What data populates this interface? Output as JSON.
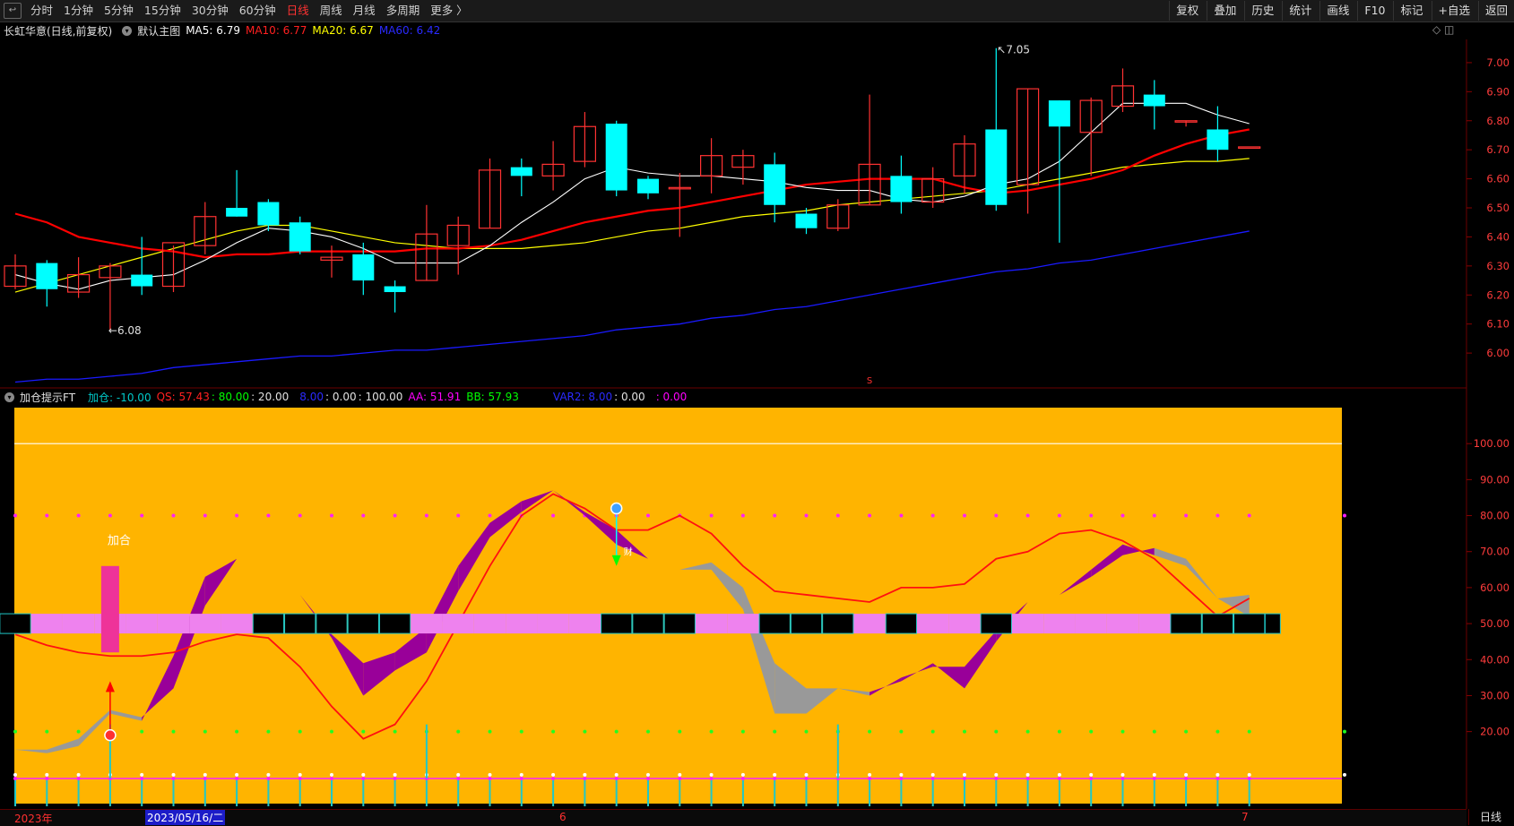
{
  "toolbar": {
    "back_icon": "back-arrow-icon",
    "periods": [
      "分时",
      "1分钟",
      "5分钟",
      "15分钟",
      "30分钟",
      "60分钟",
      "日线",
      "周线",
      "月线",
      "多周期",
      "更多 〉"
    ],
    "active_period": "日线",
    "right_buttons": [
      "复权",
      "叠加",
      "历史",
      "统计",
      "画线",
      "F10",
      "标记",
      "+自选",
      "返回"
    ]
  },
  "main_info": {
    "stock": "长虹华意(日线,前复权)",
    "template": "默认主图",
    "ma5": "MA5: 6.79",
    "ma10": "MA10: 6.77",
    "ma20": "MA20: 6.67",
    "ma60": "MA60: 6.42",
    "controls": "◇ ◫"
  },
  "indicator_info": {
    "name": "加仓提示FT",
    "jiacang": "加仓: -10.00",
    "qs": "QS: 57.43",
    "v1": ": 80.00",
    "v2": ": 20.00",
    "v3": "8.00",
    "v4": ": 0.00",
    "v5": ": 100.00",
    "aa": "AA: 51.91",
    "bb": "BB: 57.93",
    "var2": "VAR2: 8.00",
    "v6": ": 0.00",
    "v7": ": 0.00"
  },
  "annotations": {
    "high_label": "7.05",
    "low_label": "6.08",
    "jiacang_label": "加合",
    "cai_glyph": "财",
    "s_marker": "S"
  },
  "price_axis": [
    "7.00",
    "6.90",
    "6.80",
    "6.70",
    "6.60",
    "6.50",
    "6.40",
    "6.30",
    "6.20",
    "6.10",
    "6.00"
  ],
  "ind_axis": [
    "100.00",
    "90.00",
    "80.00",
    "70.00",
    "60.00",
    "50.00",
    "40.00",
    "30.00",
    "20.00"
  ],
  "date_axis": {
    "start": "2023年",
    "cursor": "2023/05/16/二",
    "m6": "6",
    "m7": "7"
  },
  "period_label": "日线",
  "colors": {
    "up": "#ff3232",
    "down": "#00ffff",
    "ma5": "#ffffff",
    "ma10": "#ff0000",
    "ma20": "#ffff00",
    "ma60": "#1a1aff",
    "panel": "#ffb400"
  },
  "chart_data": {
    "type": "candlestick",
    "ylim": [
      5.88,
      7.08
    ],
    "candles": [
      {
        "o": 6.23,
        "h": 6.34,
        "l": 6.22,
        "c": 6.3
      },
      {
        "o": 6.31,
        "h": 6.32,
        "l": 6.16,
        "c": 6.22
      },
      {
        "o": 6.21,
        "h": 6.33,
        "l": 6.19,
        "c": 6.27
      },
      {
        "o": 6.26,
        "h": 6.31,
        "l": 6.08,
        "c": 6.3
      },
      {
        "o": 6.27,
        "h": 6.4,
        "l": 6.2,
        "c": 6.23
      },
      {
        "o": 6.23,
        "h": 6.37,
        "l": 6.21,
        "c": 6.38
      },
      {
        "o": 6.37,
        "h": 6.52,
        "l": 6.34,
        "c": 6.47
      },
      {
        "o": 6.5,
        "h": 6.63,
        "l": 6.47,
        "c": 6.47
      },
      {
        "o": 6.52,
        "h": 6.53,
        "l": 6.42,
        "c": 6.44
      },
      {
        "o": 6.45,
        "h": 6.47,
        "l": 6.34,
        "c": 6.35
      },
      {
        "o": 6.32,
        "h": 6.37,
        "l": 6.26,
        "c": 6.33
      },
      {
        "o": 6.34,
        "h": 6.38,
        "l": 6.2,
        "c": 6.25
      },
      {
        "o": 6.23,
        "h": 6.25,
        "l": 6.14,
        "c": 6.21
      },
      {
        "o": 6.25,
        "h": 6.51,
        "l": 6.25,
        "c": 6.41
      },
      {
        "o": 6.37,
        "h": 6.47,
        "l": 6.27,
        "c": 6.44
      },
      {
        "o": 6.43,
        "h": 6.67,
        "l": 6.43,
        "c": 6.63
      },
      {
        "o": 6.64,
        "h": 6.67,
        "l": 6.54,
        "c": 6.61
      },
      {
        "o": 6.61,
        "h": 6.73,
        "l": 6.56,
        "c": 6.65
      },
      {
        "o": 6.66,
        "h": 6.83,
        "l": 6.64,
        "c": 6.78
      },
      {
        "o": 6.79,
        "h": 6.8,
        "l": 6.54,
        "c": 6.56
      },
      {
        "o": 6.6,
        "h": 6.61,
        "l": 6.53,
        "c": 6.55
      },
      {
        "o": 6.57,
        "h": 6.62,
        "l": 6.4,
        "c": 6.57
      },
      {
        "o": 6.61,
        "h": 6.74,
        "l": 6.55,
        "c": 6.68
      },
      {
        "o": 6.64,
        "h": 6.7,
        "l": 6.58,
        "c": 6.68
      },
      {
        "o": 6.65,
        "h": 6.69,
        "l": 6.45,
        "c": 6.51
      },
      {
        "o": 6.48,
        "h": 6.5,
        "l": 6.41,
        "c": 6.43
      },
      {
        "o": 6.43,
        "h": 6.53,
        "l": 6.42,
        "c": 6.51
      },
      {
        "o": 6.51,
        "h": 6.89,
        "l": 6.51,
        "c": 6.65
      },
      {
        "o": 6.61,
        "h": 6.68,
        "l": 6.48,
        "c": 6.52
      },
      {
        "o": 6.52,
        "h": 6.64,
        "l": 6.5,
        "c": 6.6
      },
      {
        "o": 6.61,
        "h": 6.75,
        "l": 6.55,
        "c": 6.72
      },
      {
        "o": 6.77,
        "h": 7.05,
        "l": 6.49,
        "c": 6.51
      },
      {
        "o": 6.58,
        "h": 6.91,
        "l": 6.48,
        "c": 6.91
      },
      {
        "o": 6.87,
        "h": 6.87,
        "l": 6.38,
        "c": 6.78
      },
      {
        "o": 6.76,
        "h": 6.88,
        "l": 6.61,
        "c": 6.87
      },
      {
        "o": 6.85,
        "h": 6.98,
        "l": 6.83,
        "c": 6.92
      },
      {
        "o": 6.89,
        "h": 6.94,
        "l": 6.77,
        "c": 6.85
      },
      {
        "o": 6.8,
        "h": 6.8,
        "l": 6.78,
        "c": 6.8
      },
      {
        "o": 6.77,
        "h": 6.85,
        "l": 6.66,
        "c": 6.7
      },
      {
        "o": 6.71,
        "h": 6.71,
        "l": 6.71,
        "c": 6.71
      }
    ],
    "ma5": [
      6.27,
      6.24,
      6.22,
      6.25,
      6.26,
      6.27,
      6.32,
      6.38,
      6.43,
      6.42,
      6.4,
      6.36,
      6.31,
      6.31,
      6.31,
      6.37,
      6.45,
      6.52,
      6.6,
      6.64,
      6.62,
      6.61,
      6.61,
      6.6,
      6.59,
      6.57,
      6.56,
      6.56,
      6.53,
      6.52,
      6.54,
      6.58,
      6.6,
      6.66,
      6.76,
      6.86,
      6.86,
      6.86,
      6.82,
      6.79
    ],
    "ma10": [
      6.48,
      6.45,
      6.4,
      6.38,
      6.36,
      6.35,
      6.33,
      6.34,
      6.34,
      6.35,
      6.35,
      6.35,
      6.35,
      6.36,
      6.36,
      6.37,
      6.39,
      6.42,
      6.45,
      6.47,
      6.49,
      6.5,
      6.52,
      6.54,
      6.56,
      6.58,
      6.59,
      6.6,
      6.6,
      6.6,
      6.57,
      6.55,
      6.56,
      6.58,
      6.6,
      6.63,
      6.68,
      6.72,
      6.75,
      6.77
    ],
    "ma20": [
      6.21,
      6.24,
      6.27,
      6.3,
      6.33,
      6.36,
      6.39,
      6.42,
      6.44,
      6.44,
      6.42,
      6.4,
      6.38,
      6.37,
      6.36,
      6.36,
      6.36,
      6.37,
      6.38,
      6.4,
      6.42,
      6.43,
      6.45,
      6.47,
      6.48,
      6.49,
      6.51,
      6.52,
      6.53,
      6.54,
      6.55,
      6.56,
      6.58,
      6.6,
      6.62,
      6.64,
      6.65,
      6.66,
      6.66,
      6.67
    ],
    "ma60": [
      5.9,
      5.91,
      5.91,
      5.92,
      5.93,
      5.95,
      5.96,
      5.97,
      5.98,
      5.99,
      5.99,
      6.0,
      6.01,
      6.01,
      6.02,
      6.03,
      6.04,
      6.05,
      6.06,
      6.08,
      6.09,
      6.1,
      6.12,
      6.13,
      6.15,
      6.16,
      6.18,
      6.2,
      6.22,
      6.24,
      6.26,
      6.28,
      6.29,
      6.31,
      6.32,
      6.34,
      6.36,
      6.38,
      6.4,
      6.42
    ],
    "indicator": {
      "ylim": [
        0,
        110
      ],
      "aa": [
        15,
        14,
        16,
        25,
        23,
        41,
        63,
        68,
        64,
        58,
        47,
        39,
        42,
        49,
        66,
        78,
        84,
        87,
        81,
        76,
        68,
        65,
        65,
        54,
        25,
        25,
        32,
        30,
        35,
        38,
        38,
        48,
        56,
        58,
        65,
        72,
        69,
        66,
        57,
        52
      ],
      "bb": [
        15,
        15,
        18,
        26,
        24,
        32,
        55,
        68,
        64,
        58,
        46,
        30,
        37,
        42,
        59,
        74,
        81,
        87,
        80,
        72,
        68,
        65,
        67,
        60,
        39,
        32,
        32,
        31,
        34,
        39,
        32,
        45,
        56,
        58,
        63,
        69,
        71,
        68,
        57,
        58
      ],
      "qs": [
        47,
        44,
        42,
        41,
        41,
        42,
        45,
        47,
        46,
        38,
        27,
        18,
        22,
        34,
        50,
        66,
        80,
        86,
        82,
        76,
        76,
        80,
        75,
        66,
        59,
        58,
        57,
        56,
        60,
        60,
        61,
        68,
        70,
        75,
        76,
        73,
        68,
        60,
        52,
        57
      ],
      "bar_state": [
        "k",
        "p",
        "p",
        "p",
        "p",
        "p",
        "p",
        "p",
        "k",
        "k",
        "k",
        "k",
        "k",
        "p",
        "p",
        "p",
        "p",
        "p",
        "p",
        "k",
        "k",
        "k",
        "p",
        "p",
        "k",
        "k",
        "k",
        "p",
        "k",
        "p",
        "p",
        "k",
        "p",
        "p",
        "p",
        "p",
        "p",
        "k",
        "k",
        "k"
      ],
      "signal_up": 3,
      "signal_down": 19,
      "bottom_markers": [
        3,
        13,
        26
      ]
    }
  }
}
